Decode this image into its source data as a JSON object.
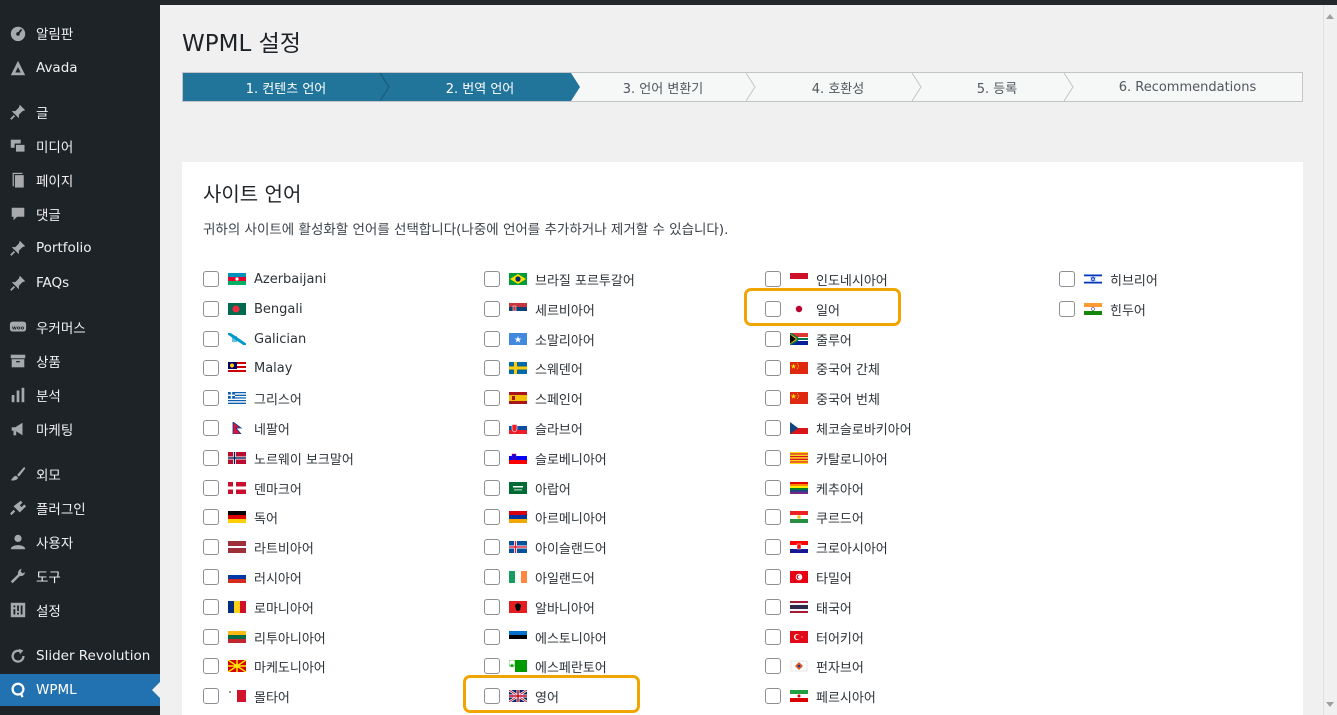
{
  "sidebar": {
    "items": [
      {
        "label": "알림판",
        "icon": "dashboard-icon"
      },
      {
        "label": "Avada",
        "icon": "avada-icon"
      },
      {
        "label": "글",
        "icon": "pin-icon"
      },
      {
        "label": "미디어",
        "icon": "media-icon"
      },
      {
        "label": "페이지",
        "icon": "page-icon"
      },
      {
        "label": "댓글",
        "icon": "comment-icon"
      },
      {
        "label": "Portfolio",
        "icon": "pin-icon"
      },
      {
        "label": "FAQs",
        "icon": "pin-icon"
      },
      {
        "label": "우커머스",
        "icon": "woo-icon"
      },
      {
        "label": "상품",
        "icon": "archive-icon"
      },
      {
        "label": "분석",
        "icon": "chart-icon"
      },
      {
        "label": "마케팅",
        "icon": "megaphone-icon"
      },
      {
        "label": "외모",
        "icon": "brush-icon"
      },
      {
        "label": "플러그인",
        "icon": "plugin-icon"
      },
      {
        "label": "사용자",
        "icon": "user-icon"
      },
      {
        "label": "도구",
        "icon": "wrench-icon"
      },
      {
        "label": "설정",
        "icon": "settings-icon"
      },
      {
        "label": "Slider Revolution",
        "icon": "refresh-icon"
      },
      {
        "label": "WPML",
        "icon": "wpml-icon"
      }
    ]
  },
  "page": {
    "title": "WPML 설정"
  },
  "steps": [
    {
      "label": "1. 컨텐츠 언어",
      "state": "done"
    },
    {
      "label": "2. 번역 언어",
      "state": "current"
    },
    {
      "label": "3. 언어 변환기",
      "state": "todo"
    },
    {
      "label": "4. 호환성",
      "state": "todo"
    },
    {
      "label": "5. 등록",
      "state": "todo"
    },
    {
      "label": "6. Recommendations",
      "state": "todo"
    }
  ],
  "card": {
    "title": "사이트 언어",
    "description": "귀하의 사이트에 활성화할 언어를 선택합니다(나중에 언어를 추가하거나 제거할 수 있습니다)."
  },
  "languages": {
    "col1": [
      {
        "label": "Azerbaijani",
        "flag": "az"
      },
      {
        "label": "Bengali",
        "flag": "bd"
      },
      {
        "label": "Galician",
        "flag": "gl"
      },
      {
        "label": "Malay",
        "flag": "my"
      },
      {
        "label": "그리스어",
        "flag": "gr"
      },
      {
        "label": "네팔어",
        "flag": "np"
      },
      {
        "label": "노르웨이 보크말어",
        "flag": "no"
      },
      {
        "label": "덴마크어",
        "flag": "dk"
      },
      {
        "label": "독어",
        "flag": "de"
      },
      {
        "label": "라트비아어",
        "flag": "lv"
      },
      {
        "label": "러시아어",
        "flag": "ru"
      },
      {
        "label": "로마니아어",
        "flag": "ro"
      },
      {
        "label": "리투아니아어",
        "flag": "lt"
      },
      {
        "label": "마케도니아어",
        "flag": "mk"
      },
      {
        "label": "몰타어",
        "flag": "mt"
      }
    ],
    "col2": [
      {
        "label": "브라질 포르투갈어",
        "flag": "br"
      },
      {
        "label": "세르비아어",
        "flag": "rs"
      },
      {
        "label": "소말리아어",
        "flag": "so"
      },
      {
        "label": "스웨덴어",
        "flag": "se"
      },
      {
        "label": "스페인어",
        "flag": "es"
      },
      {
        "label": "슬라브어",
        "flag": "sk"
      },
      {
        "label": "슬로베니아어",
        "flag": "si"
      },
      {
        "label": "아랍어",
        "flag": "ar"
      },
      {
        "label": "아르메니아어",
        "flag": "am"
      },
      {
        "label": "아이슬랜드어",
        "flag": "is"
      },
      {
        "label": "아일랜드어",
        "flag": "ie"
      },
      {
        "label": "알바니아어",
        "flag": "al"
      },
      {
        "label": "에스토니아어",
        "flag": "ee"
      },
      {
        "label": "에스페란토어",
        "flag": "eo"
      },
      {
        "label": "영어",
        "flag": "gb"
      }
    ],
    "col3": [
      {
        "label": "인도네시아어",
        "flag": "id"
      },
      {
        "label": "일어",
        "flag": "jp"
      },
      {
        "label": "줄루어",
        "flag": "za"
      },
      {
        "label": "중국어 간체",
        "flag": "cn"
      },
      {
        "label": "중국어 번체",
        "flag": "cn"
      },
      {
        "label": "체코슬로바키아어",
        "flag": "cz"
      },
      {
        "label": "카탈로니아어",
        "flag": "ca"
      },
      {
        "label": "케추아어",
        "flag": "qu"
      },
      {
        "label": "쿠르드어",
        "flag": "ku"
      },
      {
        "label": "크로아시아어",
        "flag": "hr"
      },
      {
        "label": "타밀어",
        "flag": "tn"
      },
      {
        "label": "태국어",
        "flag": "th"
      },
      {
        "label": "터어키어",
        "flag": "tr"
      },
      {
        "label": "펀자브어",
        "flag": "pa"
      },
      {
        "label": "페르시아어",
        "flag": "ir"
      }
    ],
    "col4": [
      {
        "label": "히브리어",
        "flag": "il"
      },
      {
        "label": "힌두어",
        "flag": "in"
      }
    ]
  },
  "highlighted": [
    "일어",
    "영어"
  ],
  "colors": {
    "accent": "#21759b",
    "sidebar": "#1d2327",
    "active_menu": "#2271b1",
    "highlight": "#f0a500"
  }
}
